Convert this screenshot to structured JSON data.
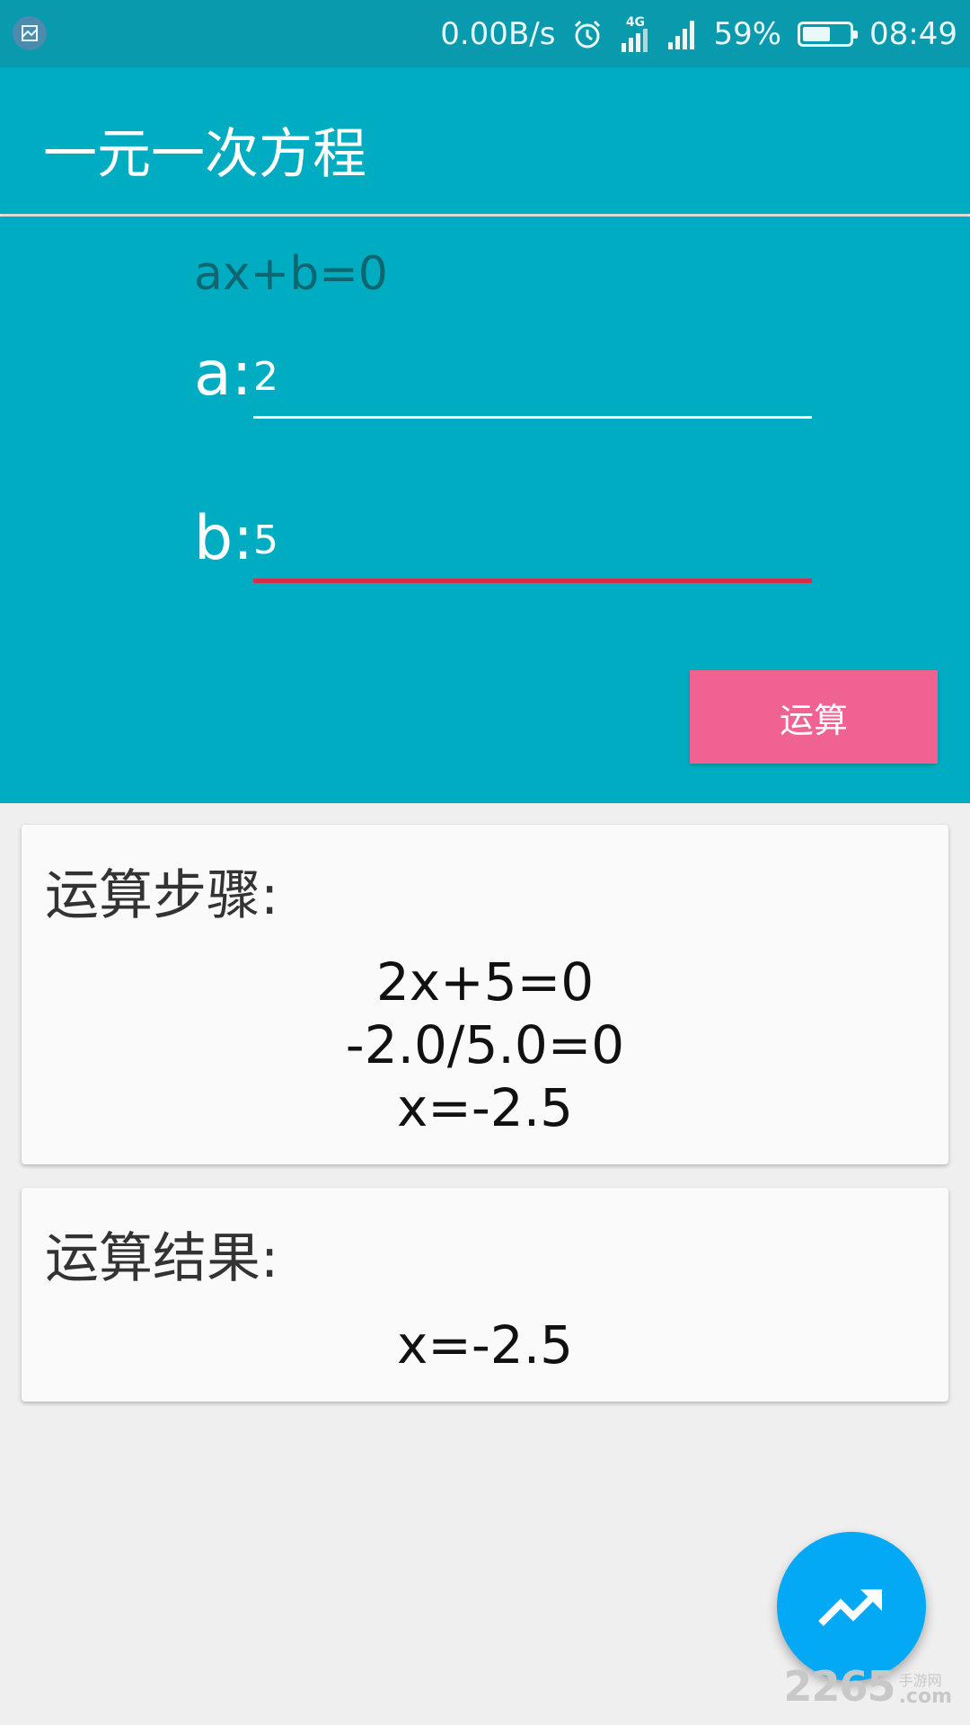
{
  "status_bar": {
    "net_speed": "0.00B/s",
    "network_type": "4G",
    "battery_percent_text": "59%",
    "battery_level": 0.59,
    "time": "08:49",
    "icons": [
      "screenshot-icon",
      "alarm-icon",
      "4g-signal-icon",
      "signal-icon",
      "battery-icon"
    ]
  },
  "app_bar": {
    "title": "一元一次方程"
  },
  "input_panel": {
    "formula": "ax+b=0",
    "a_label": "a:",
    "a_value": "2",
    "b_label": "b:",
    "b_value": "5",
    "calc_button": "运算"
  },
  "steps_card": {
    "title": "运算步骤:",
    "lines": [
      "2x+5=0",
      "-2.0/5.0=0",
      "x=-2.5"
    ]
  },
  "result_card": {
    "title": "运算结果:",
    "value": "x=-2.5"
  },
  "fab": {
    "icon": "trending-up-icon"
  },
  "watermark": {
    "main": "2265",
    "suffix": ".com",
    "side": "手游网"
  },
  "colors": {
    "status_bar": "#0a9aad",
    "primary": "#00acc1",
    "accent_button": "#f06292",
    "focus_underline": "#d32f4b",
    "fab": "#03a9f4",
    "background": "#efefef"
  }
}
